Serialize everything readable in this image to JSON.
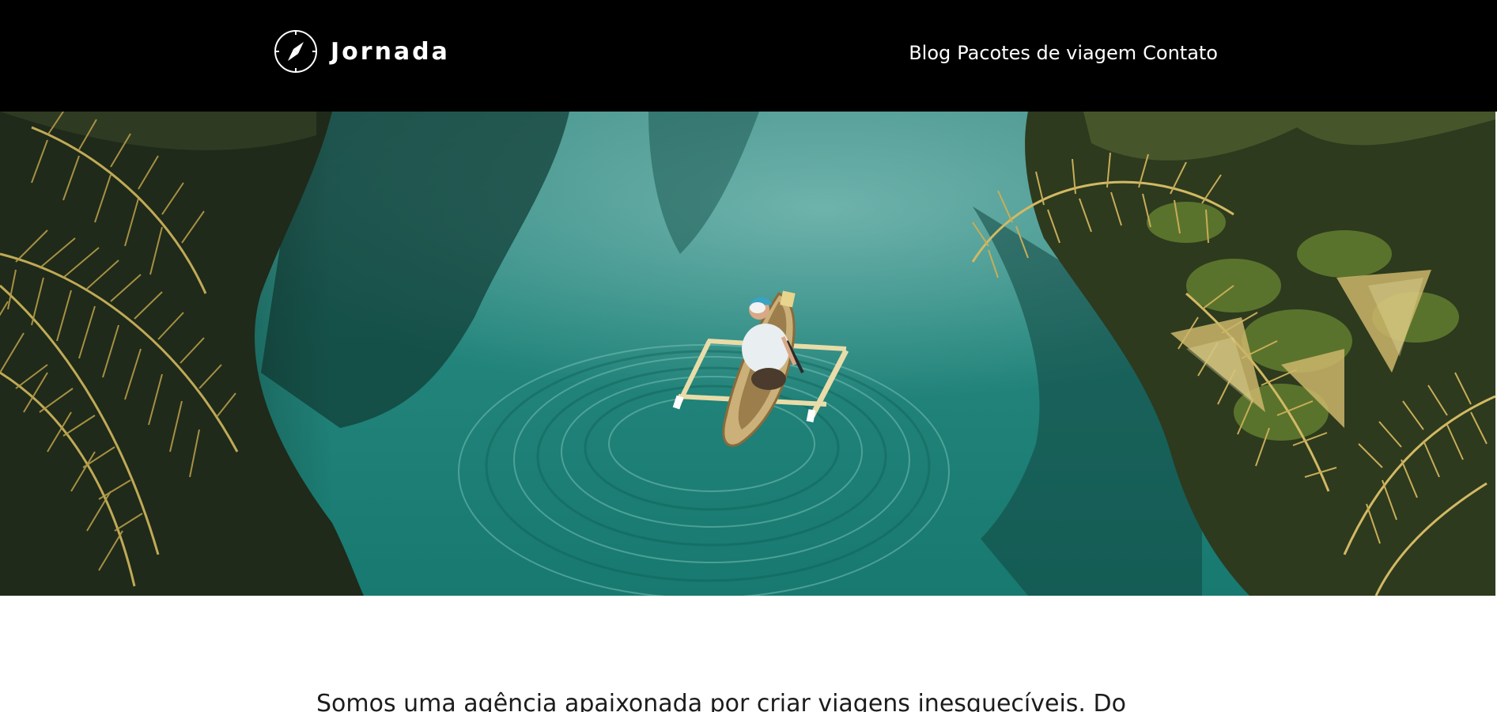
{
  "header": {
    "brand": "Jornada",
    "logo_icon": "compass-icon",
    "nav": [
      {
        "label": "Blog"
      },
      {
        "label": "Pacotes de viagem"
      },
      {
        "label": "Contato"
      }
    ]
  },
  "hero": {
    "image": "aerial-river-canoe-photo"
  },
  "intro": {
    "text": "Somos uma agência apaixonada por criar viagens inesquecíveis. Do"
  },
  "colors": {
    "header_bg": "#000000",
    "header_text": "#ffffff",
    "body_text": "#1c1c1c",
    "water": "#1d7f75"
  }
}
